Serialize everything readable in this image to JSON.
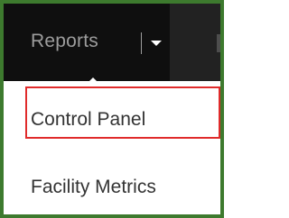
{
  "navbar": {
    "reports_label": "Reports",
    "caret_icon": "caret-down-icon"
  },
  "dropdown": {
    "items": [
      {
        "label": "Control Panel",
        "highlighted": true
      },
      {
        "label": "Facility Metrics",
        "highlighted": false
      }
    ]
  },
  "colors": {
    "frame": "#3d7a2e",
    "navbar": "#222222",
    "highlight_border": "#e02b2b",
    "menu_text": "#333333",
    "nav_text": "#9d9d9d"
  }
}
